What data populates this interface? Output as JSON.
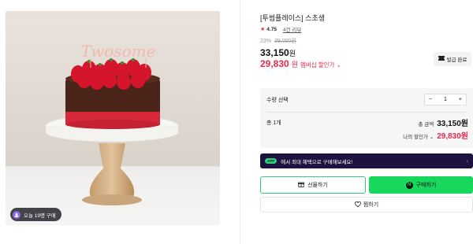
{
  "gallery": {
    "image_alt": "Twosome strawberry chocolate cake on a white cake stand",
    "cake_topper_text": "Twosome",
    "buy_badge": "오늘 19명 구매"
  },
  "product": {
    "title": "[투썸플레이스] 스초생",
    "rating_star": "★",
    "rating": "4.75",
    "reviews": "4건 리뷰",
    "discount_rate": "23%",
    "original_price": "39,000원",
    "price": "33,150",
    "price_unit": "원",
    "member_price": "29,830",
    "member_unit": "원",
    "member_label": "멤버십 할인가 ⌄",
    "coupon_label": "발급 완료"
  },
  "options": {
    "header": "수량 선택",
    "qty_minus": "−",
    "qty_value": "1",
    "qty_plus": "+",
    "qty_count": "총 1개",
    "total_label": "총 금액",
    "total_value": "33,150원",
    "discount_label": "나의 할인가 ⌄",
    "discount_value": "29,830원"
  },
  "promo": {
    "tag": "APP",
    "text": "에서 최대 혜택으로 구매해보세요!",
    "arrow": "›"
  },
  "actions": {
    "gift": "선물하기",
    "buy": "구매하기",
    "wish": "찜하기"
  },
  "colors": {
    "accent_green": "#17d85c",
    "member_red": "#e8294a",
    "promo_bg": "#1e1340"
  }
}
